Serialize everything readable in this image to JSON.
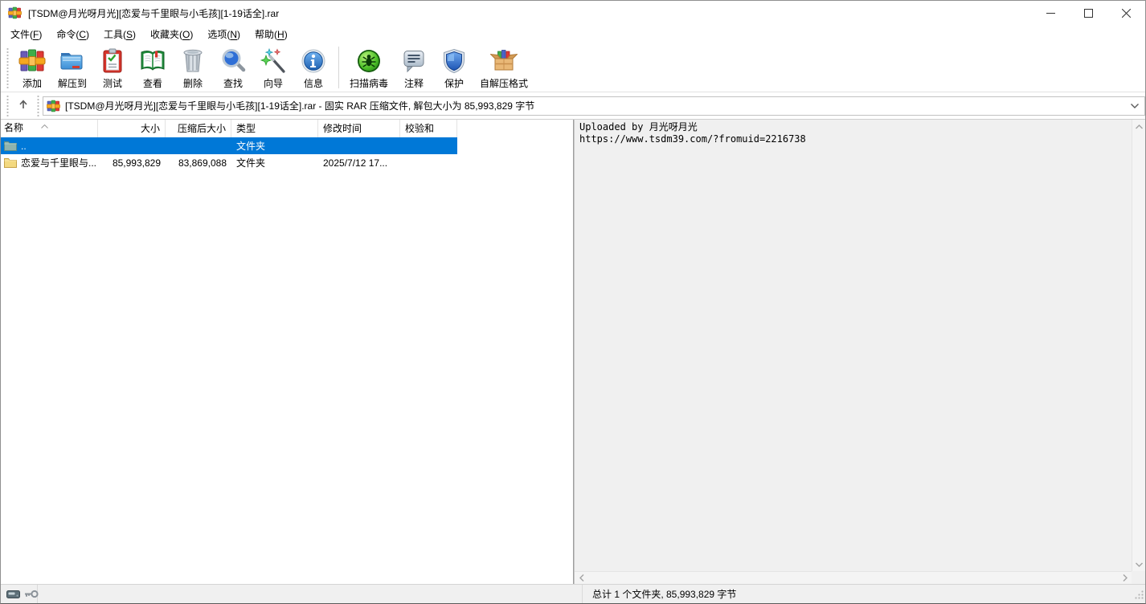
{
  "window": {
    "title": "[TSDM@月光呀月光][恋爱与千里眼与小毛孩][1-19话全].rar"
  },
  "menubar": {
    "items": [
      {
        "pre": "文件(",
        "key": "F",
        "post": ")"
      },
      {
        "pre": "命令(",
        "key": "C",
        "post": ")"
      },
      {
        "pre": "工具(",
        "key": "S",
        "post": ")"
      },
      {
        "pre": "收藏夹(",
        "key": "O",
        "post": ")"
      },
      {
        "pre": "选项(",
        "key": "N",
        "post": ")"
      },
      {
        "pre": "帮助(",
        "key": "H",
        "post": ")"
      }
    ]
  },
  "toolbar": {
    "buttons": [
      {
        "icon": "add-books-icon",
        "label": "添加"
      },
      {
        "icon": "extract-folder-icon",
        "label": "解压到"
      },
      {
        "icon": "test-clipboard-icon",
        "label": "测试"
      },
      {
        "icon": "view-book-icon",
        "label": "查看"
      },
      {
        "icon": "delete-trash-icon",
        "label": "删除"
      },
      {
        "icon": "find-magnifier-icon",
        "label": "查找"
      },
      {
        "icon": "wizard-wand-icon",
        "label": "向导"
      },
      {
        "icon": "info-icon",
        "label": "信息"
      },
      {
        "icon": "virus-scan-icon",
        "label": "扫描病毒"
      },
      {
        "icon": "comment-bubble-icon",
        "label": "注释"
      },
      {
        "icon": "protect-shield-icon",
        "label": "保护"
      },
      {
        "icon": "sfx-box-icon",
        "label": "自解压格式"
      }
    ]
  },
  "addressbar": {
    "combo_text": "[TSDM@月光呀月光][恋爱与千里眼与小毛孩][1-19话全].rar - 固实 RAR 压缩文件, 解包大小为 85,993,829 字节"
  },
  "list": {
    "columns": [
      {
        "label": "名称"
      },
      {
        "label": "大小"
      },
      {
        "label": "压缩后大小"
      },
      {
        "label": "类型"
      },
      {
        "label": "修改时间"
      },
      {
        "label": "校验和"
      }
    ],
    "rows": [
      {
        "name": "..",
        "size": "",
        "packed": "",
        "type": "文件夹",
        "modified": "",
        "checksum": ""
      },
      {
        "name": "恋爱与千里眼与...",
        "size": "85,993,829",
        "packed": "83,869,088",
        "type": "文件夹",
        "modified": "2025/7/12 17...",
        "checksum": ""
      }
    ]
  },
  "comment": {
    "lines": [
      "Uploaded by 月光呀月光",
      "https://www.tsdm39.com/?fromuid=2216738"
    ]
  },
  "statusbar": {
    "total": "总计 1 个文件夹, 85,993,829 字节"
  },
  "colors": {
    "selection": "#0078d7",
    "window_bg": "#ffffff",
    "comment_bg": "#f0f0f0",
    "statusbar_bg": "#f0f0f0"
  },
  "icons": {
    "winrar-app-icon": "stacked books with strap",
    "up-arrow-icon": "↑",
    "chevron-down-icon": "⌄",
    "sort-up-icon": "∧",
    "folder-up-icon": "teal folder (parent)",
    "folder-icon": "yellow folder",
    "minimize-icon": "—",
    "maximize-icon": "□",
    "close-icon": "✕",
    "disk-icon": "drive",
    "key-icon": "key",
    "scroll-up-icon": "∧",
    "scroll-down-icon": "∨",
    "scroll-left-icon": "‹",
    "scroll-right-icon": "›"
  }
}
